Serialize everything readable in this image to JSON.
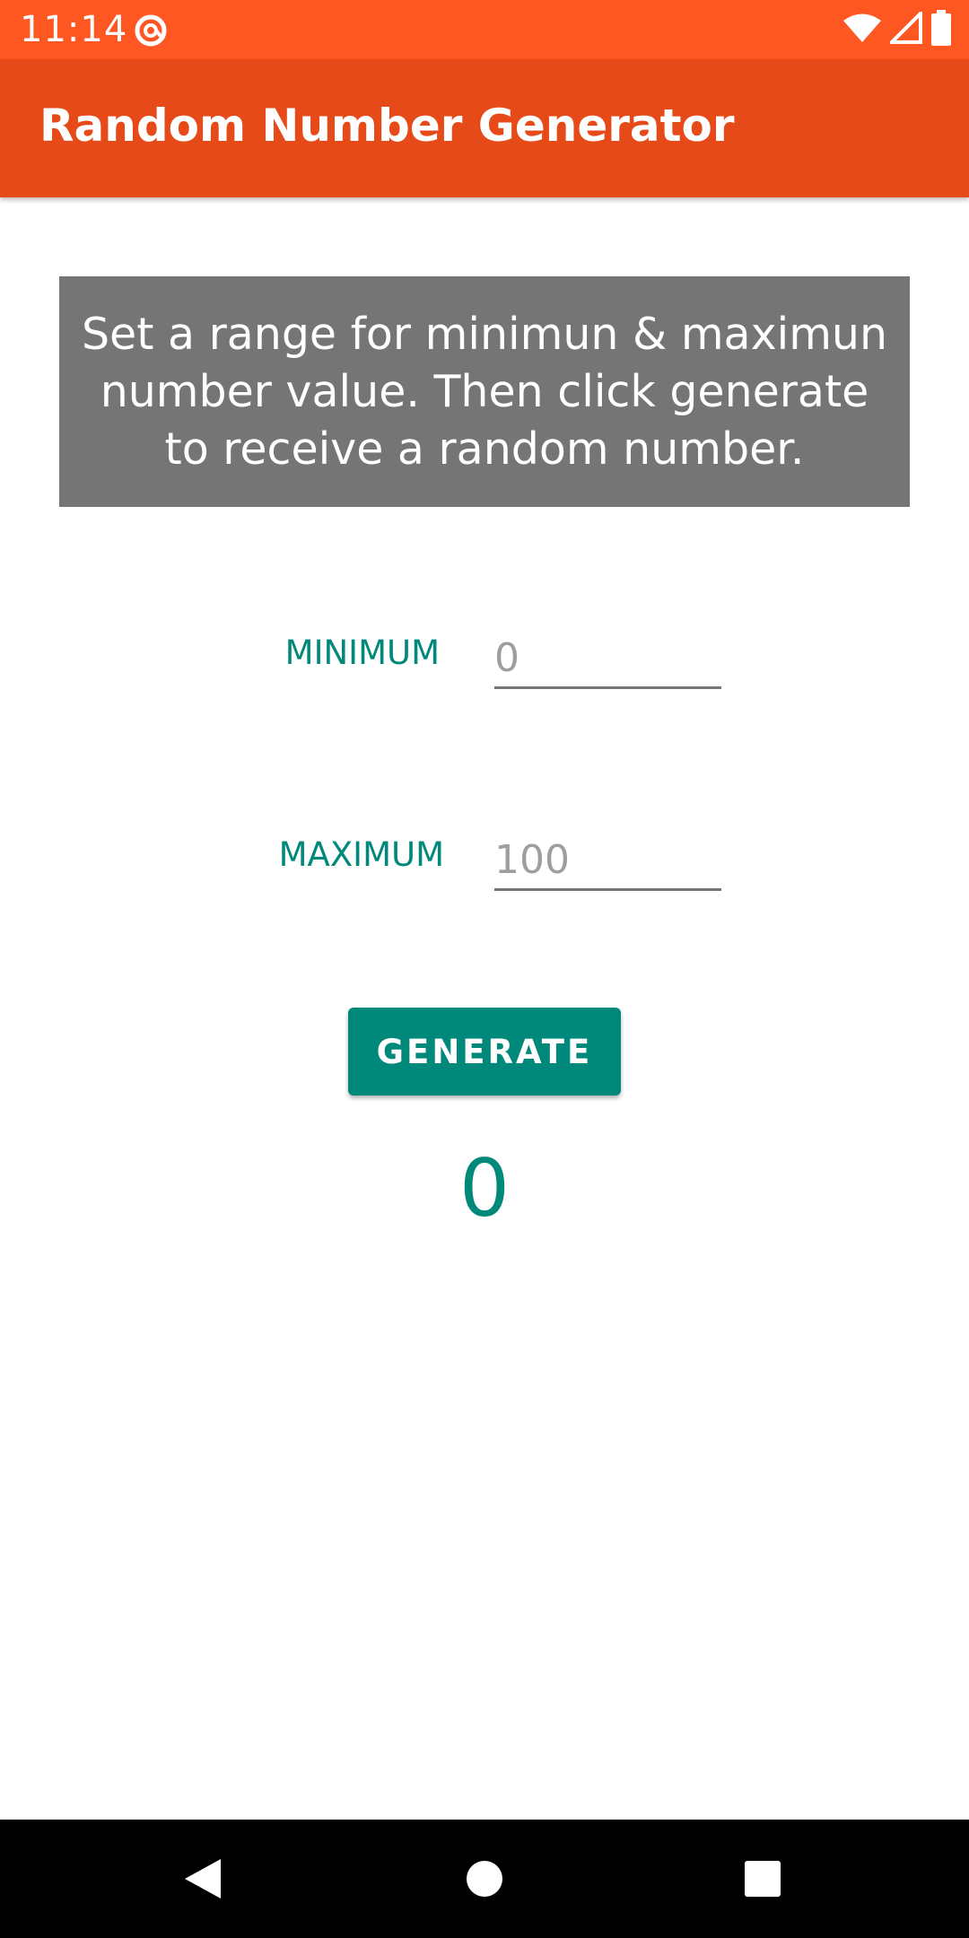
{
  "status_bar": {
    "time": "11:14",
    "background": "#ff5722",
    "icons": [
      "at-sign-notification-icon",
      "wifi-icon",
      "cell-signal-icon",
      "battery-icon"
    ]
  },
  "app_bar": {
    "title": "Random Number Generator",
    "background": "#e64a19"
  },
  "instructions": {
    "text": "Set a range for minimun & maximun number value. Then click generate to receive a random number.",
    "background": "#757575"
  },
  "minimum": {
    "label": "MINIMUM",
    "placeholder": "0",
    "value": ""
  },
  "maximum": {
    "label": "MAXIMUM",
    "placeholder": "100",
    "value": ""
  },
  "generate_button": {
    "label": "GENERATE",
    "background": "#00897b"
  },
  "result": {
    "value": "0"
  },
  "nav_bar": {
    "buttons": [
      "back-icon",
      "home-icon",
      "recents-icon"
    ]
  },
  "colors": {
    "accent": "#00897b",
    "primary": "#e64a19",
    "primary_dark": "#ff5722"
  }
}
